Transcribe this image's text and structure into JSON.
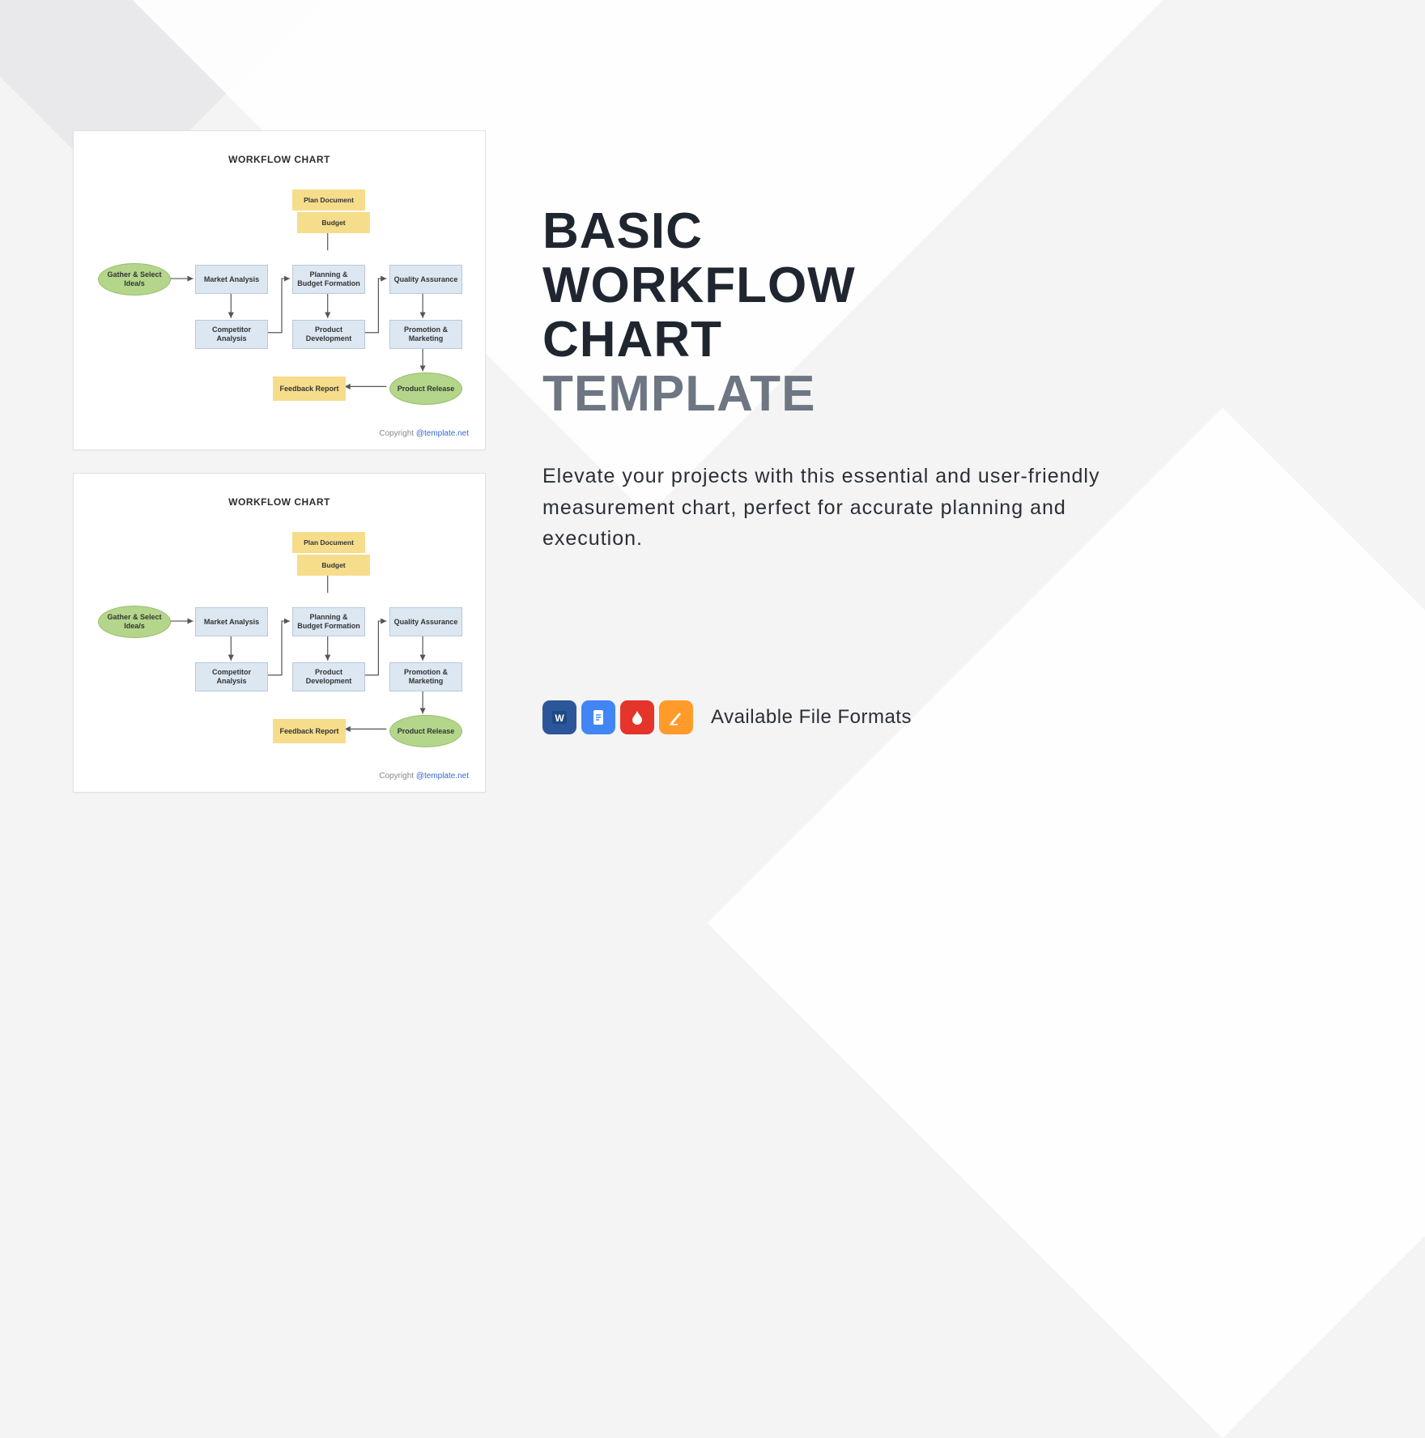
{
  "heading": {
    "line1": "BASIC",
    "line2": "WORKFLOW",
    "line3": "CHART",
    "line4": "TEMPLATE"
  },
  "description": "Elevate your projects with this essential and user-friendly measurement chart, perfect for accurate planning and execution.",
  "formats_label": "Available File Formats",
  "format_icons": [
    "word",
    "google-docs",
    "pdf",
    "apple-pages"
  ],
  "thumbnail": {
    "title": "WORKFLOW CHART",
    "copyright_prefix": "Copyright ",
    "copyright_link": "@template.net",
    "nodes": {
      "gather": "Gather & Select Idea/s",
      "market_analysis": "Market Analysis",
      "competitor": "Competitor Analysis",
      "planning": "Planning & Budget Formation",
      "product_dev": "Product Development",
      "plan_doc": "Plan Document",
      "budget": "Budget",
      "qa": "Quality Assurance",
      "promo": "Promotion & Marketing",
      "feedback": "Feedback Report",
      "release": "Product Release"
    }
  }
}
